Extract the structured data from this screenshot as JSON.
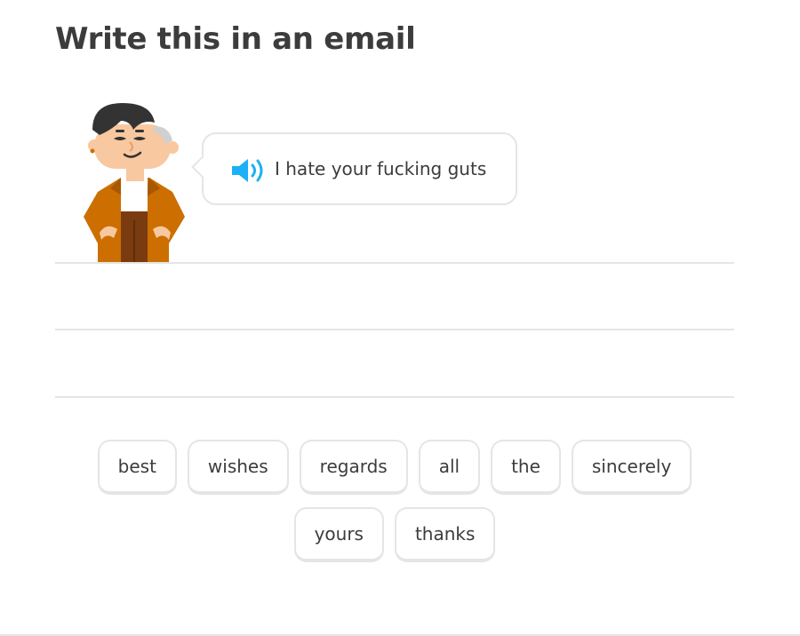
{
  "header": {
    "title": "Write this in an email"
  },
  "prompt": {
    "character_name": "character-avatar",
    "speaker_icon": "speaker-icon",
    "text": "I hate your fucking guts"
  },
  "colors": {
    "speaker": "#1cb0f6",
    "border": "#e5e5e5",
    "text": "#3c3c3c"
  },
  "word_bank": {
    "row1": [
      "best",
      "wishes",
      "regards",
      "all",
      "the",
      "sincerely"
    ],
    "row2": [
      "yours",
      "thanks"
    ]
  }
}
